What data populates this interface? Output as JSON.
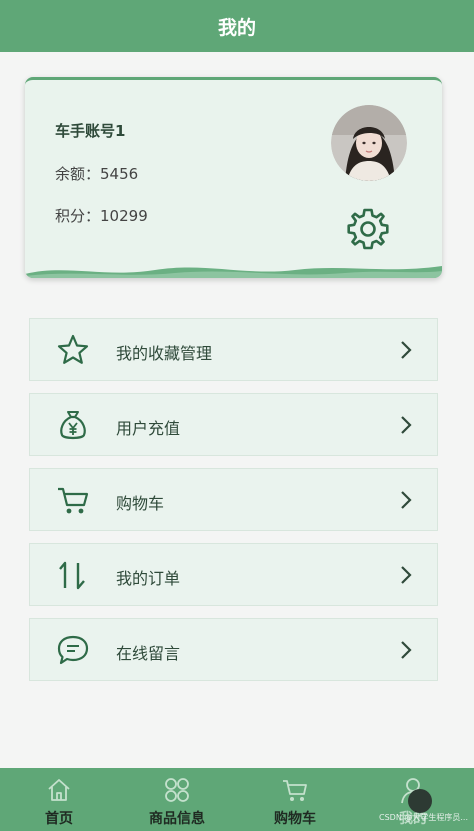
{
  "header": {
    "title": "我的"
  },
  "profile": {
    "account_name": "车手账号1",
    "balance_label": "余额：",
    "balance_value": "5456",
    "points_label": "积分：",
    "points_value": "10299"
  },
  "menu": [
    {
      "label": "我的收藏管理",
      "icon": "star-icon"
    },
    {
      "label": "用户充值",
      "icon": "money-bag-icon"
    },
    {
      "label": "购物车",
      "icon": "cart-icon"
    },
    {
      "label": "我的订单",
      "icon": "order-arrows-icon"
    },
    {
      "label": "在线留言",
      "icon": "chat-bubble-icon"
    }
  ],
  "tabbar": [
    {
      "label": "首页",
      "icon": "home-icon"
    },
    {
      "label": "商品信息",
      "icon": "grid-icon"
    },
    {
      "label": "购物车",
      "icon": "cart-icon"
    },
    {
      "label": "我的",
      "icon": "user-icon"
    }
  ],
  "watermark": "CSDN @大学生程序员...",
  "colors": {
    "primary": "#5fa777",
    "card_bg": "#e9f3ed",
    "icon": "#2f6b48"
  }
}
